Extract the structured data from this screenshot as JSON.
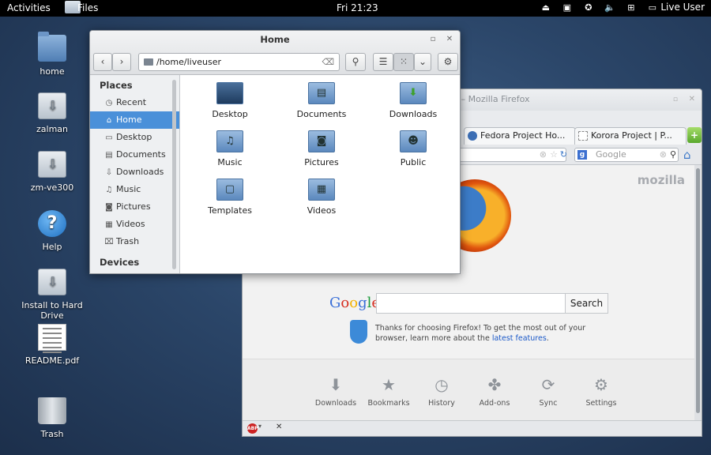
{
  "topbar": {
    "activities": "Activities",
    "app_name": "Files",
    "clock": "Fri 21:23",
    "user": "Live User",
    "tray_icons": [
      "eject-icon",
      "display-icon",
      "accessibility-icon",
      "volume-icon",
      "network-icon",
      "user-icon"
    ]
  },
  "desktop": {
    "icons": [
      {
        "label": "home",
        "icon": "home-folder-icon"
      },
      {
        "label": "zalman",
        "icon": "drive-icon"
      },
      {
        "label": "zm-ve300",
        "icon": "drive-icon"
      },
      {
        "label": "Help",
        "icon": "help-icon"
      },
      {
        "label": "Install to Hard Drive",
        "icon": "install-icon"
      },
      {
        "label": "README.pdf",
        "icon": "pdf-icon"
      },
      {
        "label": "Trash",
        "icon": "trash-icon"
      }
    ]
  },
  "files": {
    "title": "Home",
    "path": "/home/liveuser",
    "sidebar": {
      "places_heading": "Places",
      "items": [
        {
          "label": "Recent",
          "icon": "clock-icon"
        },
        {
          "label": "Home",
          "icon": "home-icon",
          "selected": true
        },
        {
          "label": "Desktop",
          "icon": "desktop-icon"
        },
        {
          "label": "Documents",
          "icon": "documents-icon"
        },
        {
          "label": "Downloads",
          "icon": "download-icon"
        },
        {
          "label": "Music",
          "icon": "music-icon"
        },
        {
          "label": "Pictures",
          "icon": "pictures-icon"
        },
        {
          "label": "Videos",
          "icon": "videos-icon"
        },
        {
          "label": "Trash",
          "icon": "trash-icon"
        }
      ],
      "devices_heading": "Devices"
    },
    "folders": [
      "Desktop",
      "Documents",
      "Downloads",
      "Music",
      "Pictures",
      "Public",
      "Templates",
      "Videos"
    ]
  },
  "firefox": {
    "title": "art Page – Mozilla Firefox",
    "tabs": [
      "Fedora Project Ho...",
      "Korora Project | P..."
    ],
    "search_placeholder": "Google",
    "mozilla": "mozilla",
    "google": "Google",
    "search_button": "Search",
    "thanks_text": "Thanks for choosing Firefox! To get the most out of your browser, learn more about the ",
    "thanks_link": "latest features",
    "launcher": [
      "Downloads",
      "Bookmarks",
      "History",
      "Add-ons",
      "Sync",
      "Settings"
    ],
    "abp": "ABP"
  }
}
